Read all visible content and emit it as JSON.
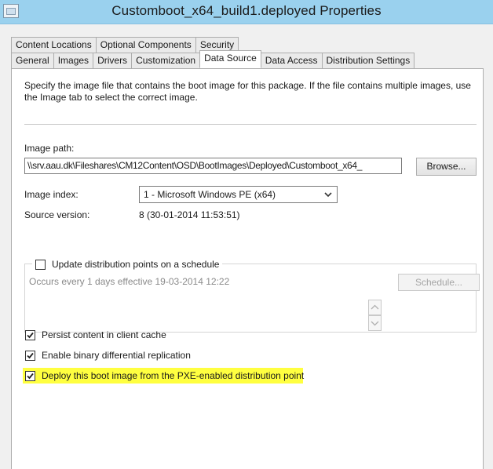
{
  "window": {
    "title": "Customboot_x64_build1.deployed Properties",
    "accent_color": "#9ad1ee"
  },
  "tabs": {
    "row1": [
      "Content Locations",
      "Optional Components",
      "Security"
    ],
    "row2": [
      "General",
      "Images",
      "Drivers",
      "Customization",
      "Data Source",
      "Data Access",
      "Distribution Settings"
    ],
    "active": "Data Source"
  },
  "data_source": {
    "description": "Specify the image file that contains the boot image for this package. If the file contains multiple images, use the Image tab to select the correct image.",
    "image_path_label": "Image path:",
    "image_path_value": "\\\\srv.aau.dk\\Fileshares\\CM12Content\\OSD\\BootImages\\Deployed\\Customboot_x64_",
    "browse_label": "Browse...",
    "image_index_label": "Image index:",
    "image_index_value": "1 - Microsoft Windows PE (x64)",
    "source_version_label": "Source version:",
    "source_version_value": "8 (30-01-2014 11:53:51)"
  },
  "schedule": {
    "checkbox_label": "Update distribution points on a schedule",
    "checked": false,
    "occurs_text": "Occurs every 1 days effective 19-03-2014 12:22",
    "schedule_button": "Schedule..."
  },
  "options": [
    {
      "label": "Persist content in client cache",
      "checked": true,
      "highlighted": false
    },
    {
      "label": "Enable binary differential replication",
      "checked": true,
      "highlighted": false
    },
    {
      "label": "Deploy this boot image from the PXE-enabled distribution point",
      "checked": true,
      "highlighted": true
    }
  ],
  "colors": {
    "highlight": "#ffff40",
    "dialog_bg": "#f0f0f0"
  }
}
